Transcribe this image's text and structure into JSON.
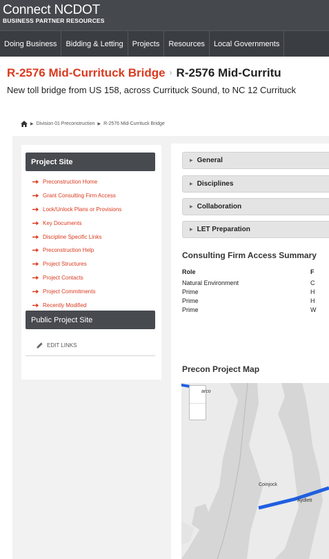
{
  "header": {
    "brand": "Connect NCDOT",
    "subtitle": "BUSINESS PARTNER RESOURCES"
  },
  "nav": {
    "items": [
      "Doing Business",
      "Bidding & Letting",
      "Projects",
      "Resources",
      "Local Governments"
    ]
  },
  "page": {
    "title_primary": "R-2576 Mid-Currituck Bridge",
    "title_secondary": "R-2576 Mid-Curritu",
    "description": "New toll bridge from US 158, across Currituck Sound, to NC 12 Currituck"
  },
  "breadcrumb": {
    "items": [
      "Division 01 Preconstruction",
      "R-2576 Mid-Currituck Bridge"
    ]
  },
  "sidebar": {
    "heading": "Project Site",
    "items": [
      "Preconstruction Home",
      "Grant Consulting Firm Access",
      "Lock/Unlock Plans or Provisions",
      "Key Documents",
      "Discipline Specific Links",
      "Preconstruction Help",
      "Project Structures",
      "Project Contacts",
      "Project Commitments",
      "Recently Modified"
    ],
    "public_heading": "Public Project Site",
    "edit_links": "EDIT LINKS"
  },
  "accordion": {
    "items": [
      "General",
      "Disciplines",
      "Collaboration",
      "LET Preparation"
    ]
  },
  "summary": {
    "title": "Consulting Firm Access Summary",
    "col_role": "Role",
    "col_firm": "F",
    "rows": [
      {
        "role": "Natural Environment",
        "firm": "C"
      },
      {
        "role": "Prime",
        "firm": "H"
      },
      {
        "role": "Prime",
        "firm": "H"
      },
      {
        "role": "Prime",
        "firm": "W"
      }
    ]
  },
  "map": {
    "title": "Precon Project Map",
    "labels": {
      "top": "arco",
      "coinjock": "Coinjock",
      "aydlett": "Aydlett"
    }
  },
  "colors": {
    "accent_red": "#d93a1f",
    "header_bg": "#45484d",
    "nav_bg": "#3a3d42",
    "route_blue": "#1f5fe0"
  }
}
